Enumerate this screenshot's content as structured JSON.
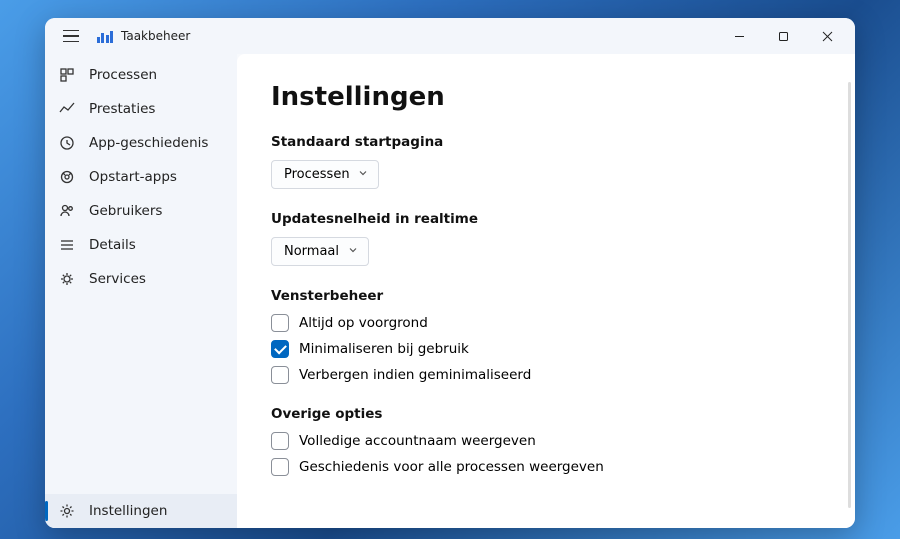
{
  "app": {
    "title": "Taakbeheer"
  },
  "sidebar": {
    "items": [
      {
        "label": "Processen"
      },
      {
        "label": "Prestaties"
      },
      {
        "label": "App-geschiedenis"
      },
      {
        "label": "Opstart-apps"
      },
      {
        "label": "Gebruikers"
      },
      {
        "label": "Details"
      },
      {
        "label": "Services"
      }
    ],
    "settings_label": "Instellingen"
  },
  "page": {
    "title": "Instellingen",
    "default_page": {
      "label": "Standaard startpagina",
      "value": "Processen"
    },
    "update_speed": {
      "label": "Updatesnelheid in realtime",
      "value": "Normaal"
    },
    "window_mgmt": {
      "label": "Vensterbeheer",
      "opts": [
        {
          "label": "Altijd op voorgrond",
          "checked": false
        },
        {
          "label": "Minimaliseren bij gebruik",
          "checked": true
        },
        {
          "label": "Verbergen indien geminimaliseerd",
          "checked": false
        }
      ]
    },
    "other": {
      "label": "Overige opties",
      "opts": [
        {
          "label": "Volledige accountnaam weergeven",
          "checked": false
        },
        {
          "label": "Geschiedenis voor alle processen weergeven",
          "checked": false
        }
      ]
    }
  }
}
